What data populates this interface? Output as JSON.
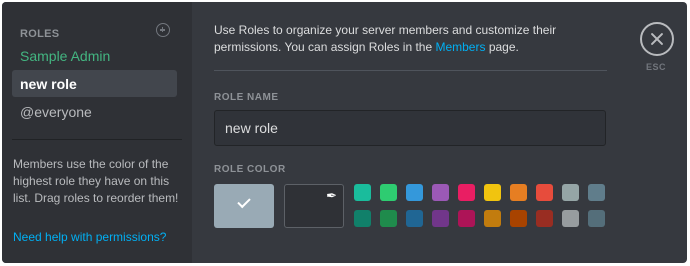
{
  "sidebar": {
    "header": "ROLES",
    "add_icon": "add-circle-icon",
    "roles": [
      {
        "label": "Sample Admin",
        "color": "#43b581"
      },
      {
        "label": "new role",
        "color": "#ffffff"
      },
      {
        "label": "@everyone",
        "color": "#b9bbbe"
      }
    ],
    "help_text": "Members use the color of the highest role they have on this list. Drag roles to reorder them!",
    "help_link": "Need help with permissions?"
  },
  "intro": {
    "text_before": "Use Roles to organize your server members and customize their permissions. You can assign Roles in the ",
    "link": "Members",
    "text_after": " page."
  },
  "close": {
    "icon": "close-icon",
    "label": "ESC"
  },
  "role_name": {
    "label": "ROLE NAME",
    "value": "new role"
  },
  "role_color": {
    "label": "ROLE COLOR",
    "default_color": "#99aab5",
    "selected": "default",
    "custom_icon": "eyedropper-icon",
    "palette_row1": [
      "#1abc9c",
      "#2ecc71",
      "#3498db",
      "#9b59b6",
      "#e91e63",
      "#f1c40f",
      "#e67e22",
      "#e74c3c",
      "#95a5a6",
      "#607d8b"
    ],
    "palette_row2": [
      "#11806a",
      "#1f8b4c",
      "#206694",
      "#71368a",
      "#ad1457",
      "#c27c0e",
      "#a84300",
      "#992d22",
      "#979c9f",
      "#546e7a"
    ]
  }
}
